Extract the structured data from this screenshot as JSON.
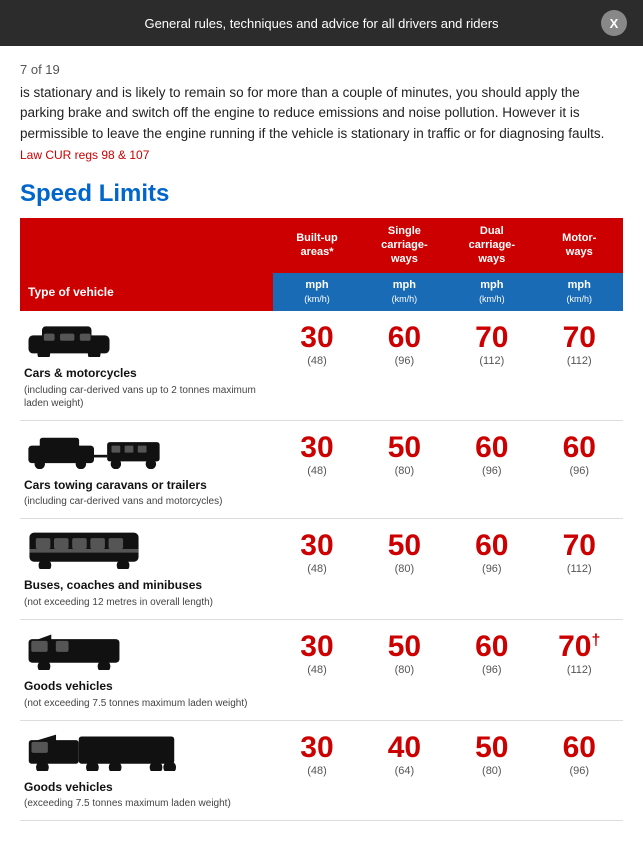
{
  "header": {
    "title": "General rules, techniques and advice for all drivers and riders",
    "close_label": "X"
  },
  "page_indicator": "7 of 19",
  "intro": {
    "text": "is stationary and is likely to remain so for more than a couple of minutes, you should apply the parking brake and switch off the engine to reduce emissions and noise pollution. However it is permissible to leave the engine running if the vehicle is stationary in traffic or for diagnosing faults.",
    "law_ref": "Law CUR regs 98 & 107"
  },
  "speed_limits": {
    "title": "Speed Limits",
    "column_headers": [
      {
        "id": "vehicle",
        "label": "Type of vehicle"
      },
      {
        "id": "builtup",
        "label": "Built-up areas*"
      },
      {
        "id": "single",
        "label": "Single carriage-ways"
      },
      {
        "id": "dual",
        "label": "Dual carriage-ways"
      },
      {
        "id": "motorway",
        "label": "Motorways"
      }
    ],
    "unit_label": "mph\n(km/h)",
    "rows": [
      {
        "icon": "car",
        "name": "Cars & motorcycles",
        "desc": "(including car-derived vans up to 2 tonnes maximum laden weight)",
        "builtup": "30",
        "builtup_kmh": "(48)",
        "single": "60",
        "single_kmh": "(96)",
        "dual": "70",
        "dual_kmh": "(112)",
        "motorway": "70",
        "motorway_kmh": "(112)",
        "motorway_sup": ""
      },
      {
        "icon": "car-caravan",
        "name": "Cars towing caravans or trailers",
        "desc": "(including car-derived vans and motorcycles)",
        "builtup": "30",
        "builtup_kmh": "(48)",
        "single": "50",
        "single_kmh": "(80)",
        "dual": "60",
        "dual_kmh": "(96)",
        "motorway": "60",
        "motorway_kmh": "(96)",
        "motorway_sup": ""
      },
      {
        "icon": "bus",
        "name": "Buses, coaches and minibuses",
        "desc": "(not exceeding 12 metres in overall length)",
        "builtup": "30",
        "builtup_kmh": "(48)",
        "single": "50",
        "single_kmh": "(80)",
        "dual": "60",
        "dual_kmh": "(96)",
        "motorway": "70",
        "motorway_kmh": "(112)",
        "motorway_sup": ""
      },
      {
        "icon": "van",
        "name": "Goods vehicles",
        "desc": "(not exceeding 7.5 tonnes maximum laden weight)",
        "builtup": "30",
        "builtup_kmh": "(48)",
        "single": "50",
        "single_kmh": "(80)",
        "dual": "60",
        "dual_kmh": "(96)",
        "motorway": "70",
        "motorway_kmh": "(112)",
        "motorway_sup": "†"
      },
      {
        "icon": "truck",
        "name": "Goods vehicles",
        "desc": "(exceeding 7.5 tonnes maximum laden weight)",
        "builtup": "30",
        "builtup_kmh": "(48)",
        "single": "40",
        "single_kmh": "(64)",
        "dual": "50",
        "dual_kmh": "(80)",
        "motorway": "60",
        "motorway_kmh": "(96)",
        "motorway_sup": ""
      }
    ]
  }
}
